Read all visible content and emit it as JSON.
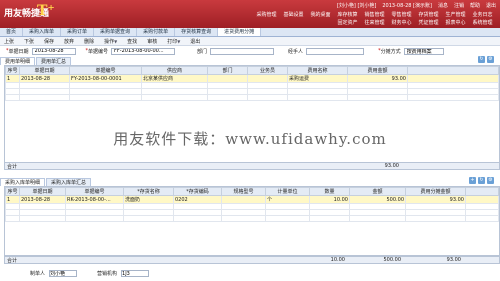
{
  "app": {
    "logo_text": "用友畅捷通",
    "logo_t": "T⁺",
    "status": [
      "[刘小艳] [刘小艳]",
      "2013-08-28 [演示账]",
      "消息",
      "注销",
      "帮助",
      "退出"
    ]
  },
  "menu_row1": [
    "采购管理",
    "基础设置",
    "我的桌面",
    "库存核算",
    "销售管理",
    "零售管理",
    "存货管理",
    "生产管理",
    "业务日志"
  ],
  "menu_row2": [
    "固定资产",
    "往来管理",
    "财务中心",
    "凭证管理",
    "报表中心",
    "系统管理"
  ],
  "tabs": [
    "首页",
    "采购入库单",
    "采购订单",
    "采购单据查询",
    "采购付款单",
    "存货核算查询",
    "进货费用分摊"
  ],
  "active_tab_index": 6,
  "toolbar": [
    "上张",
    "下张",
    "保存",
    "放弃",
    "删除",
    "操作",
    "查找",
    "审核",
    "打印",
    "退出"
  ],
  "header": {
    "date_label": "单据日期",
    "date_value": "2013-08-28",
    "number_label": "单据编号",
    "number_value": "FF-2013-08-00-00...",
    "dept_label": "部门",
    "clerk_label": "经手人",
    "method_label": "分摊方式",
    "method_value": "按费用档案"
  },
  "upper_tabs": [
    "费用单明细",
    "费用单汇总"
  ],
  "upper_grid": {
    "columns": [
      "序号",
      "单据日期",
      "单据编号",
      "供应商",
      "部门",
      "业务员",
      "费用名称",
      "费用金额"
    ],
    "rows": [
      [
        "1",
        "2013-08-28",
        "FY-2013-08-00-0001",
        "北京某供应商",
        "",
        "",
        "采购运费",
        "93.00"
      ]
    ],
    "total_label": "合计",
    "total_value": "93.00"
  },
  "lower_tabs": [
    "采购入库单明细",
    "采购入库单汇总"
  ],
  "lower_grid": {
    "columns": [
      "序号",
      "单据日期",
      "单据编号",
      "*存货名称",
      "*存货编码",
      "规格型号",
      "计量单位",
      "数量",
      "金额",
      "费用分摊金额"
    ],
    "rows": [
      [
        "1",
        "2013-08-28",
        "RK-2013-08-00-...",
        "洗面奶",
        "0202",
        "",
        "个",
        "10.00",
        "500.00",
        "93.00"
      ]
    ],
    "total_label": "合计",
    "total_qty": "10.00",
    "total_amount": "500.00",
    "total_fee": "93.00"
  },
  "footer": {
    "maker_label": "制单人",
    "maker_value": "刘小艳",
    "org_label": "营销机构",
    "org_value": "1J3"
  },
  "watermark": "用友软件下载：www.ufidawhy.com"
}
